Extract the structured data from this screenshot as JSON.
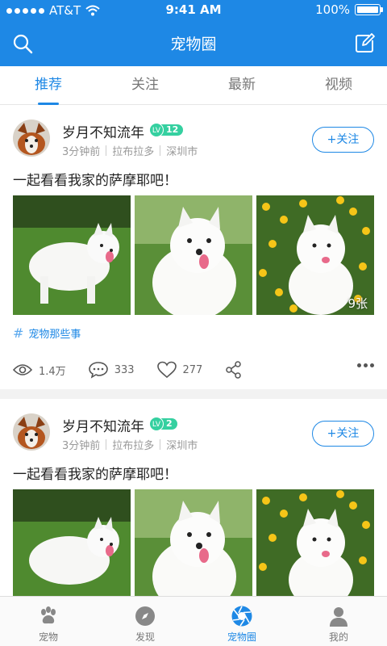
{
  "status_bar": {
    "carrier": "AT&T",
    "time": "9:41 AM",
    "battery": "100%"
  },
  "nav": {
    "title": "宠物圈",
    "search_icon": "search-icon",
    "edit_icon": "edit-icon"
  },
  "tabs": [
    {
      "label": "推荐",
      "active": true
    },
    {
      "label": "关注",
      "active": false
    },
    {
      "label": "最新",
      "active": false
    },
    {
      "label": "视频",
      "active": false
    }
  ],
  "posts": [
    {
      "username": "岁月不知流年",
      "level_badge": "LV",
      "level": "12",
      "time": "3分钟前",
      "breed": "拉布拉多",
      "city": "深圳市",
      "follow_label": "+关注",
      "text": "一起看看我家的萨摩耶吧！",
      "image_count": "9张",
      "topic": "宠物那些事",
      "views": "1.4万",
      "comments": "333",
      "likes": "277"
    },
    {
      "username": "岁月不知流年",
      "level_badge": "LV",
      "level": "2",
      "time": "3分钟前",
      "breed": "拉布拉多",
      "city": "深圳市",
      "follow_label": "+关注",
      "text": "一起看看我家的萨摩耶吧！"
    }
  ],
  "tabbar": [
    {
      "label": "宠物",
      "icon": "paw-icon",
      "active": false
    },
    {
      "label": "发现",
      "icon": "compass-icon",
      "active": false
    },
    {
      "label": "宠物圈",
      "icon": "aperture-icon",
      "active": true
    },
    {
      "label": "我的",
      "icon": "user-icon",
      "active": false
    }
  ],
  "colors": {
    "brand": "#1e88e5",
    "level_badge": "#35d0a0"
  }
}
